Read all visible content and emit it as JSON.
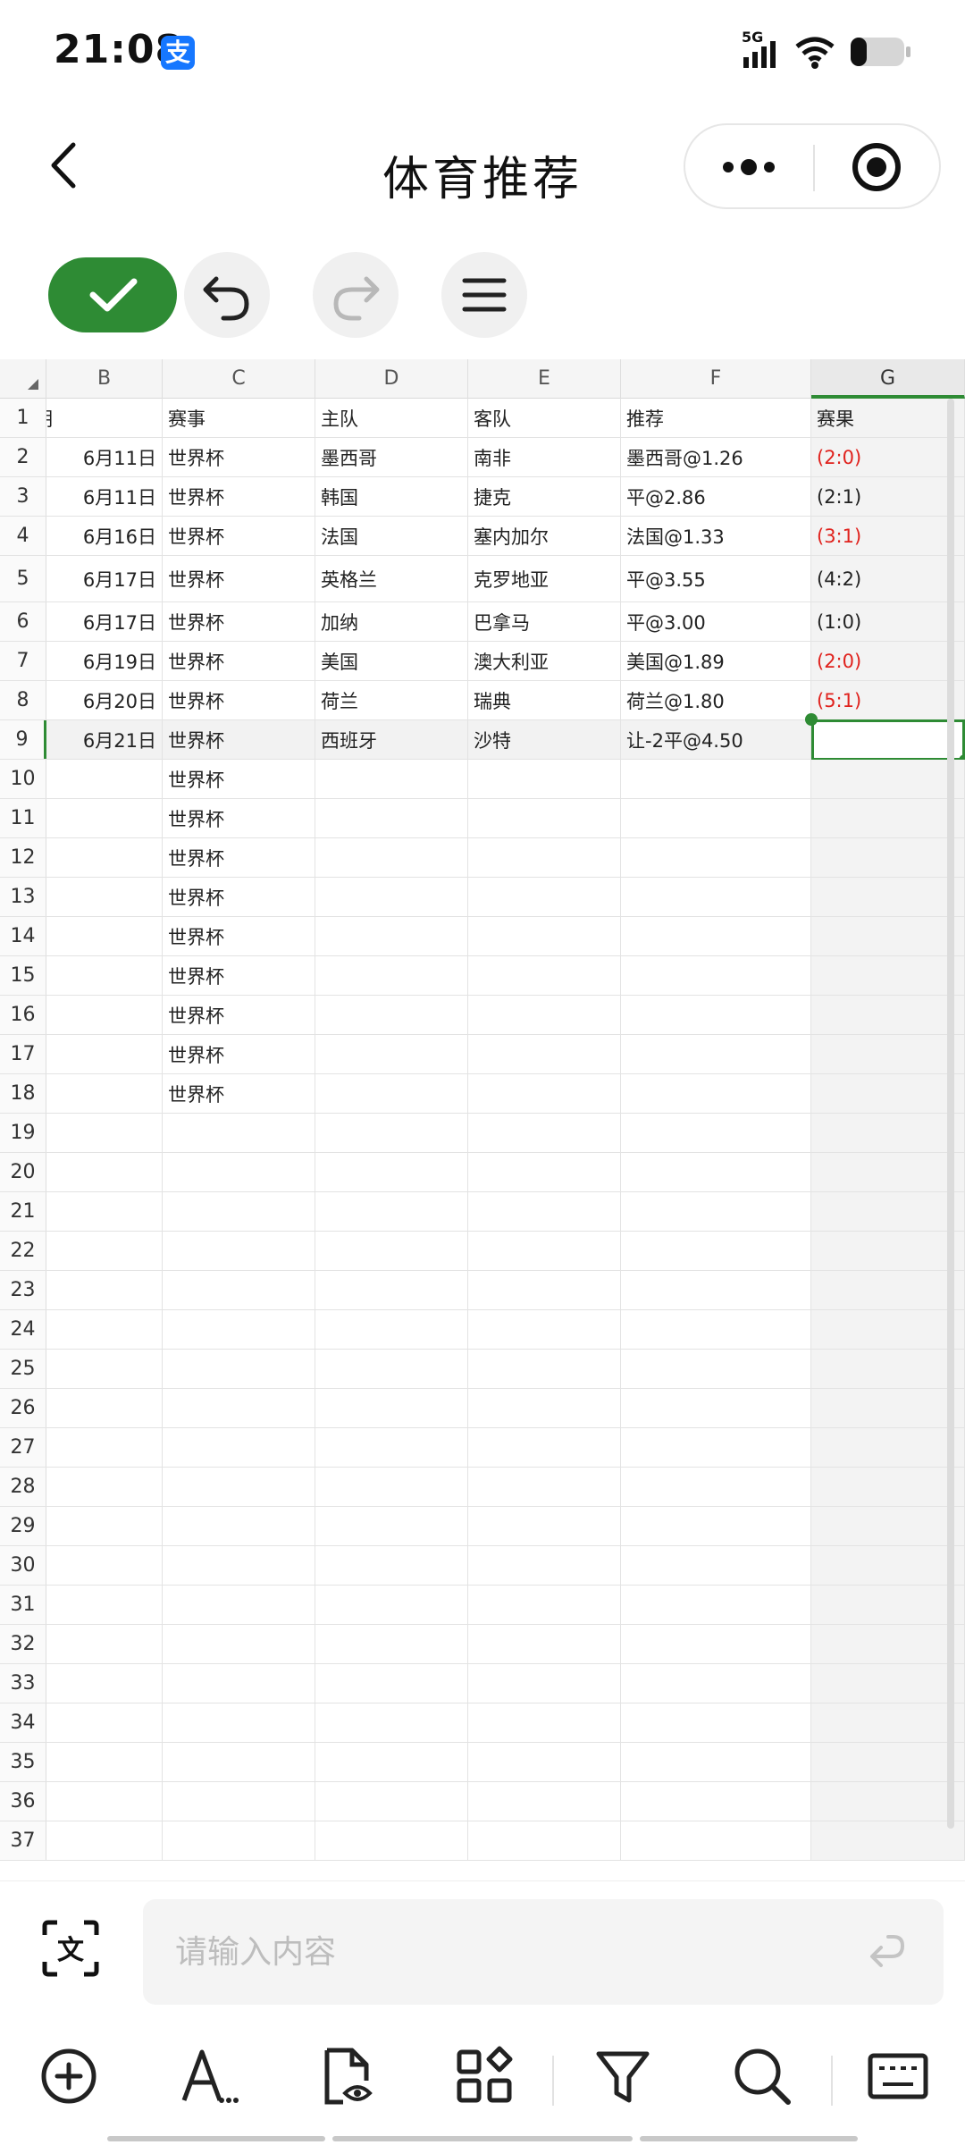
{
  "status_bar": {
    "time": "21:08",
    "app_badge": "支",
    "network": "5G",
    "icons": [
      "signal-icon",
      "wifi-icon",
      "battery-icon"
    ]
  },
  "header": {
    "title": "体育推荐"
  },
  "sheet": {
    "columns": [
      "B",
      "C",
      "D",
      "E",
      "F",
      "G"
    ],
    "selected_column": "G",
    "header_row": [
      "",
      "赛事",
      "主队",
      "客队",
      "推荐",
      "赛果"
    ],
    "header_row_clipped_prefix": "期",
    "rows": [
      {
        "num": "2",
        "date": "6月11日",
        "event": "世界杯",
        "home": "墨西哥",
        "away": "南非",
        "pick": "墨西哥@1.26",
        "result": "(2:0)",
        "hit": true
      },
      {
        "num": "3",
        "date": "6月11日",
        "event": "世界杯",
        "home": "韩国",
        "away": "捷克",
        "pick": "平@2.86",
        "result": "(2:1)",
        "hit": false
      },
      {
        "num": "4",
        "date": "6月16日",
        "event": "世界杯",
        "home": "法国",
        "away": "塞内加尔",
        "pick": "法国@1.33",
        "result": "(3:1)",
        "hit": true
      },
      {
        "num": "5",
        "date": "6月17日",
        "event": "世界杯",
        "home": "英格兰",
        "away": "克罗地亚",
        "pick": "平@3.55",
        "result": "(4:2)",
        "hit": false
      },
      {
        "num": "6",
        "date": "6月17日",
        "event": "世界杯",
        "home": "加纳",
        "away": "巴拿马",
        "pick": "平@3.00",
        "result": "(1:0)",
        "hit": false
      },
      {
        "num": "7",
        "date": "6月19日",
        "event": "世界杯",
        "home": "美国",
        "away": "澳大利亚",
        "pick": "美国@1.89",
        "result": "(2:0)",
        "hit": true
      },
      {
        "num": "8",
        "date": "6月20日",
        "event": "世界杯",
        "home": "荷兰",
        "away": "瑞典",
        "pick": "荷兰@1.80",
        "result": "(5:1)",
        "hit": true
      },
      {
        "num": "9",
        "date": "6月21日",
        "event": "世界杯",
        "home": "西班牙",
        "away": "沙特",
        "pick": "让-2平@4.50",
        "result": "",
        "hit": false
      },
      {
        "num": "10",
        "date": "",
        "event": "世界杯",
        "home": "",
        "away": "",
        "pick": "",
        "result": "",
        "hit": false
      },
      {
        "num": "11",
        "date": "",
        "event": "世界杯",
        "home": "",
        "away": "",
        "pick": "",
        "result": "",
        "hit": false
      },
      {
        "num": "12",
        "date": "",
        "event": "世界杯",
        "home": "",
        "away": "",
        "pick": "",
        "result": "",
        "hit": false
      },
      {
        "num": "13",
        "date": "",
        "event": "世界杯",
        "home": "",
        "away": "",
        "pick": "",
        "result": "",
        "hit": false
      },
      {
        "num": "14",
        "date": "",
        "event": "世界杯",
        "home": "",
        "away": "",
        "pick": "",
        "result": "",
        "hit": false
      },
      {
        "num": "15",
        "date": "",
        "event": "世界杯",
        "home": "",
        "away": "",
        "pick": "",
        "result": "",
        "hit": false
      },
      {
        "num": "16",
        "date": "",
        "event": "世界杯",
        "home": "",
        "away": "",
        "pick": "",
        "result": "",
        "hit": false
      },
      {
        "num": "17",
        "date": "",
        "event": "世界杯",
        "home": "",
        "away": "",
        "pick": "",
        "result": "",
        "hit": false
      },
      {
        "num": "18",
        "date": "",
        "event": "世界杯",
        "home": "",
        "away": "",
        "pick": "",
        "result": "",
        "hit": false
      },
      {
        "num": "19",
        "date": "",
        "event": "",
        "home": "",
        "away": "",
        "pick": "",
        "result": "",
        "hit": false
      },
      {
        "num": "20",
        "date": "",
        "event": "",
        "home": "",
        "away": "",
        "pick": "",
        "result": "",
        "hit": false
      },
      {
        "num": "21",
        "date": "",
        "event": "",
        "home": "",
        "away": "",
        "pick": "",
        "result": "",
        "hit": false
      },
      {
        "num": "22",
        "date": "",
        "event": "",
        "home": "",
        "away": "",
        "pick": "",
        "result": "",
        "hit": false
      },
      {
        "num": "23",
        "date": "",
        "event": "",
        "home": "",
        "away": "",
        "pick": "",
        "result": "",
        "hit": false
      },
      {
        "num": "24",
        "date": "",
        "event": "",
        "home": "",
        "away": "",
        "pick": "",
        "result": "",
        "hit": false
      },
      {
        "num": "25",
        "date": "",
        "event": "",
        "home": "",
        "away": "",
        "pick": "",
        "result": "",
        "hit": false
      },
      {
        "num": "26",
        "date": "",
        "event": "",
        "home": "",
        "away": "",
        "pick": "",
        "result": "",
        "hit": false
      },
      {
        "num": "27",
        "date": "",
        "event": "",
        "home": "",
        "away": "",
        "pick": "",
        "result": "",
        "hit": false
      },
      {
        "num": "28",
        "date": "",
        "event": "",
        "home": "",
        "away": "",
        "pick": "",
        "result": "",
        "hit": false
      },
      {
        "num": "29",
        "date": "",
        "event": "",
        "home": "",
        "away": "",
        "pick": "",
        "result": "",
        "hit": false
      },
      {
        "num": "30",
        "date": "",
        "event": "",
        "home": "",
        "away": "",
        "pick": "",
        "result": "",
        "hit": false
      },
      {
        "num": "31",
        "date": "",
        "event": "",
        "home": "",
        "away": "",
        "pick": "",
        "result": "",
        "hit": false
      },
      {
        "num": "32",
        "date": "",
        "event": "",
        "home": "",
        "away": "",
        "pick": "",
        "result": "",
        "hit": false
      },
      {
        "num": "33",
        "date": "",
        "event": "",
        "home": "",
        "away": "",
        "pick": "",
        "result": "",
        "hit": false
      },
      {
        "num": "34",
        "date": "",
        "event": "",
        "home": "",
        "away": "",
        "pick": "",
        "result": "",
        "hit": false
      },
      {
        "num": "35",
        "date": "",
        "event": "",
        "home": "",
        "away": "",
        "pick": "",
        "result": "",
        "hit": false
      },
      {
        "num": "36",
        "date": "",
        "event": "",
        "home": "",
        "away": "",
        "pick": "",
        "result": "",
        "hit": false
      },
      {
        "num": "37",
        "date": "",
        "event": "",
        "home": "",
        "away": "",
        "pick": "",
        "result": "",
        "hit": false
      }
    ],
    "active_row": "9"
  },
  "input": {
    "placeholder": "请输入内容",
    "value": ""
  },
  "colors": {
    "accent": "#2e8b34",
    "win_red": "#e0221d",
    "alipay_blue": "#1677ff"
  },
  "bottom_bar": {
    "icons": [
      "add-icon",
      "text-format-icon",
      "file-preview-icon",
      "apps-icon",
      "filter-icon",
      "search-icon",
      "keyboard-icon"
    ]
  }
}
